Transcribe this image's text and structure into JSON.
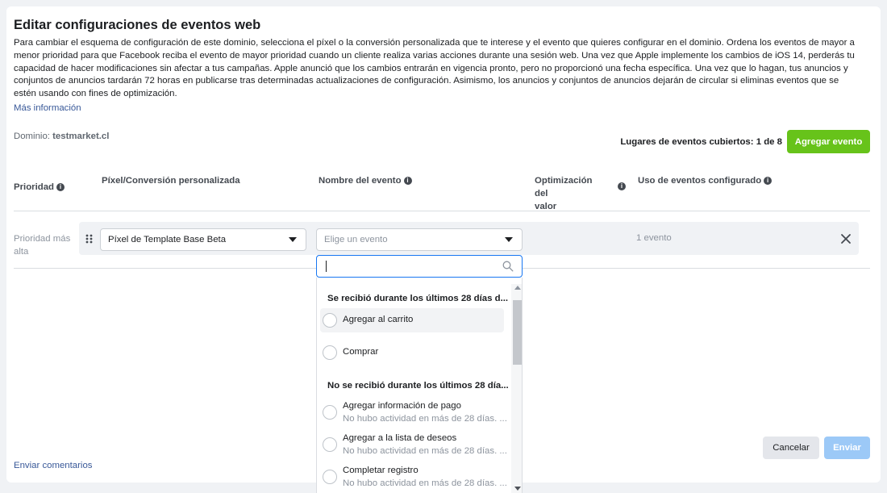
{
  "dialog": {
    "title": "Editar configuraciones de eventos web",
    "description": "Para cambiar el esquema de configuración de este dominio, selecciona el píxel o la conversión personalizada que te interese y el evento que quieres configurar en el dominio. Ordena los eventos de mayor a menor prioridad para que Facebook reciba el evento de mayor prioridad cuando un cliente realiza varias acciones durante una sesión web. Una vez que Apple implemente los cambios de iOS 14, perderás tu capacidad de hacer modificaciones sin afectar a tus campañas. Apple anunció que los cambios entrarán en vigencia pronto, pero no proporcionó una fecha específica. Una vez que lo hagan, tus anuncios y conjuntos de anuncios tardarán 72 horas en publicarse tras determinadas actualizaciones de configuración. Asimismo, los anuncios y conjuntos de anuncios dejarán de circular si eliminas eventos que se estén usando con fines de optimización.",
    "more_info": "Más información",
    "domain_label": "Dominio:",
    "domain_value": "testmarket.cl",
    "slots_text": "Lugares de eventos cubiertos: 1 de 8",
    "add_event": "Agregar evento"
  },
  "table": {
    "headers": {
      "priority": "Prioridad",
      "pixel": "Píxel/Conversión personalizada",
      "event_name": "Nombre del evento",
      "value_opt_line1": "Optimización del",
      "value_opt_line2": "valor",
      "usage": "Uso de eventos configurado"
    },
    "row": {
      "priority_line1": "Prioridad más",
      "priority_line2": "alta",
      "pixel_selected": "Píxel de Template Base Beta",
      "event_placeholder": "Elige un evento",
      "usage_count": "1 evento"
    }
  },
  "dropdown": {
    "search_value": "",
    "group_received": "Se recibió durante los últimos 28 días d...",
    "group_not_received": "No se recibió durante los últimos 28 día...",
    "items_received": [
      {
        "label": "Agregar al carrito"
      },
      {
        "label": "Comprar"
      }
    ],
    "items_not_received": [
      {
        "label": "Agregar información de pago",
        "sub": "No hubo actividad en más de 28 días. ..."
      },
      {
        "label": "Agregar a la lista de deseos",
        "sub": "No hubo actividad en más de 28 días. ..."
      },
      {
        "label": "Completar registro",
        "sub": "No hubo actividad en más de 28 días. ..."
      }
    ]
  },
  "footer": {
    "feedback": "Enviar comentarios",
    "cancel": "Cancelar",
    "send": "Enviar"
  },
  "colors": {
    "accent_green": "#67c31a",
    "link_blue": "#385898",
    "focus_blue": "#1877f2",
    "disabled_blue": "#9cc9f7"
  }
}
